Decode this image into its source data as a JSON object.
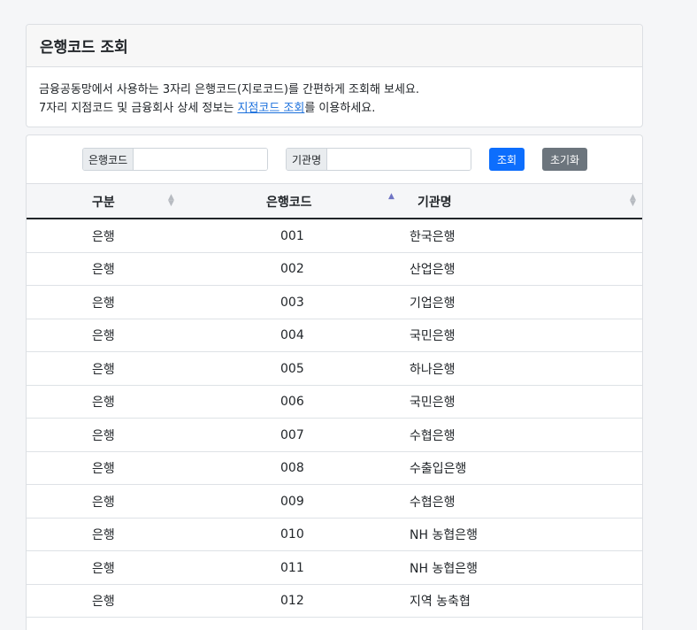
{
  "info": {
    "title": "은행코드 조회",
    "line1": "금융공동망에서 사용하는 3자리 은행코드(지로코드)를 간편하게 조회해 보세요.",
    "line2_prefix": "7자리 지점코드 및 금융회사 상세 정보는 ",
    "line2_link": "지점코드 조회",
    "line2_suffix": "를 이용하세요."
  },
  "search": {
    "code_label": "은행코드",
    "code_value": "",
    "name_label": "기관명",
    "name_value": "",
    "search_button": "조회",
    "reset_button": "초기화"
  },
  "table": {
    "columns": [
      "구분",
      "은행코드",
      "기관명"
    ],
    "sort": {
      "column": "은행코드",
      "direction": "asc"
    },
    "rows": [
      [
        "은행",
        "001",
        "한국은행"
      ],
      [
        "은행",
        "002",
        "산업은행"
      ],
      [
        "은행",
        "003",
        "기업은행"
      ],
      [
        "은행",
        "004",
        "국민은행"
      ],
      [
        "은행",
        "005",
        "하나은행"
      ],
      [
        "은행",
        "006",
        "국민은행"
      ],
      [
        "은행",
        "007",
        "수협은행"
      ],
      [
        "은행",
        "008",
        "수출입은행"
      ],
      [
        "은행",
        "009",
        "수협은행"
      ],
      [
        "은행",
        "010",
        "NH 농협은행"
      ],
      [
        "은행",
        "011",
        "NH 농협은행"
      ],
      [
        "은행",
        "012",
        "지역 농축협"
      ]
    ]
  },
  "colors": {
    "primary": "#0d6efd",
    "secondary": "#6c757d",
    "link": "#1a6fdc",
    "sort_active": "#6f74c4"
  }
}
